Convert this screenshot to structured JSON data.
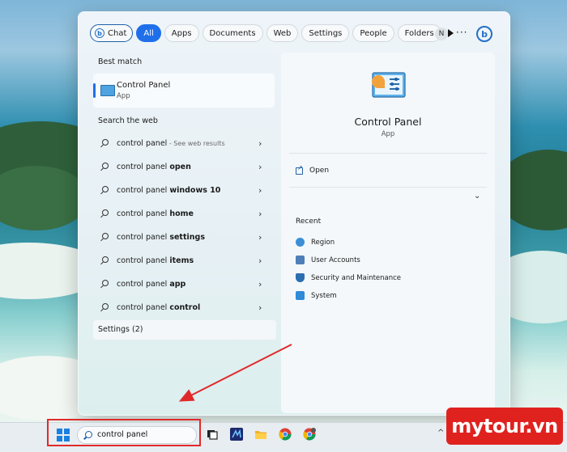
{
  "filters": [
    {
      "label": "Chat",
      "active": false
    },
    {
      "label": "All",
      "active": true
    },
    {
      "label": "Apps",
      "active": false
    },
    {
      "label": "Documents",
      "active": false
    },
    {
      "label": "Web",
      "active": false
    },
    {
      "label": "Settings",
      "active": false
    },
    {
      "label": "People",
      "active": false
    },
    {
      "label": "Folders",
      "active": false
    }
  ],
  "account_initial": "N",
  "more_label": "···",
  "sections": {
    "best_match": "Best match",
    "search_web": "Search the web",
    "settings": "Settings (2)"
  },
  "best_match": {
    "name": "Control Panel",
    "type": "App"
  },
  "web_results": [
    {
      "prefix": "control panel",
      "bold": "",
      "hint": " - See web results"
    },
    {
      "prefix": "control panel ",
      "bold": "open",
      "hint": ""
    },
    {
      "prefix": "control panel ",
      "bold": "windows 10",
      "hint": ""
    },
    {
      "prefix": "control panel ",
      "bold": "home",
      "hint": ""
    },
    {
      "prefix": "control panel ",
      "bold": "settings",
      "hint": ""
    },
    {
      "prefix": "control panel ",
      "bold": "items",
      "hint": ""
    },
    {
      "prefix": "control panel ",
      "bold": "app",
      "hint": ""
    },
    {
      "prefix": "control panel ",
      "bold": "control",
      "hint": ""
    }
  ],
  "detail": {
    "title": "Control Panel",
    "type": "App",
    "open_label": "Open",
    "recent_title": "Recent",
    "recent": [
      {
        "label": "Region",
        "color": "#3a8fd6"
      },
      {
        "label": "User Accounts",
        "color": "#4f7fb8"
      },
      {
        "label": "Security and Maintenance",
        "color": "#2a6fb0"
      },
      {
        "label": "System",
        "color": "#2f8ad8"
      }
    ]
  },
  "taskbar": {
    "search_value": "control panel"
  },
  "watermark": "mytour.vn"
}
